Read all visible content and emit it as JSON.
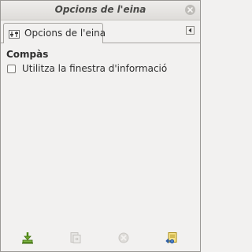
{
  "window": {
    "title": "Opcions de l'eina"
  },
  "tab": {
    "label": "Opcions de l'eina",
    "icon": "tool-options-icon"
  },
  "options": {
    "section_title": "Compàs",
    "use_info_window": {
      "label": "Utilitza la finestra d'informació",
      "checked": false
    }
  },
  "bottom_buttons": [
    {
      "name": "save-options-button",
      "icon": "save-icon",
      "enabled": true
    },
    {
      "name": "restore-options-button",
      "icon": "restore-icon",
      "enabled": false
    },
    {
      "name": "delete-options-button",
      "icon": "delete-icon",
      "enabled": false
    },
    {
      "name": "reset-options-button",
      "icon": "reset-icon",
      "enabled": true
    }
  ],
  "colors": {
    "background": "#f2f1f0",
    "accent_green": "#5a8a1c",
    "accent_yellow": "#d8b21a"
  }
}
